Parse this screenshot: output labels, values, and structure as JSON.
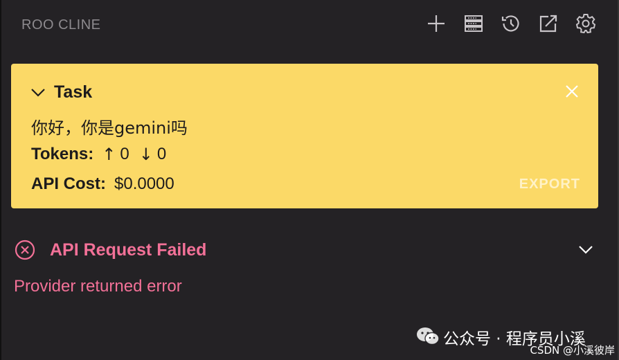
{
  "header": {
    "title": "ROO CLINE",
    "icons": [
      "plus-icon",
      "server-icon",
      "history-icon",
      "open-external-icon",
      "gear-icon"
    ]
  },
  "task": {
    "heading": "Task",
    "message": "你好，你是gemini吗",
    "tokens_label": "Tokens:",
    "tokens_up_arrow": "↑",
    "tokens_up": "0",
    "tokens_down_arrow": "↓",
    "tokens_down": "0",
    "cost_label": "API Cost:",
    "cost_value": "$0.0000",
    "export_label": "EXPORT"
  },
  "error": {
    "title": "API Request Failed",
    "message": "Provider returned error"
  },
  "watermark": {
    "line1": "公众号 · 程序员小溪",
    "line2": "CSDN @小溪彼岸"
  },
  "colors": {
    "background": "#242225",
    "task_card": "#fbd967",
    "error": "#f37198",
    "header_text": "#8d8a8e",
    "icons": "#c9c5c9"
  }
}
